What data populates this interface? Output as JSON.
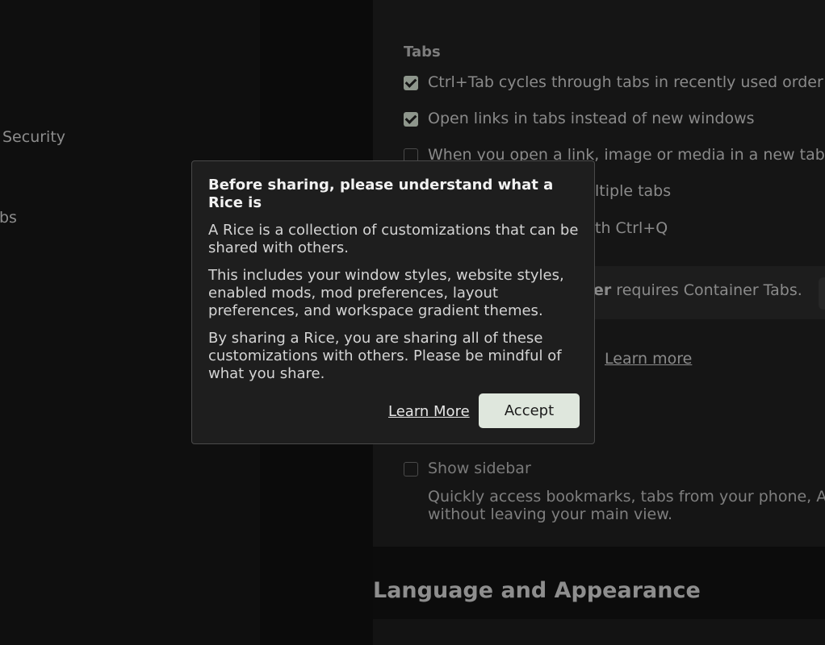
{
  "sidebar": {
    "items": [
      {
        "label": "Security"
      },
      {
        "label": "bs"
      }
    ]
  },
  "background": {
    "top_glyph": "ˇ",
    "tabs_section": {
      "title": "Tabs",
      "options": [
        {
          "label": "Ctrl+Tab cycles through tabs in recently used order",
          "checked": true
        },
        {
          "label": "Open links in tabs instead of new windows",
          "checked": true
        },
        {
          "label": "When you open a link, image or media in a new tab,",
          "checked": false
        }
      ],
      "partial_1": "ltiple tabs",
      "partial_2": "th Ctrl+Q"
    },
    "notice": {
      "bold": "er",
      "text": " requires Container Tabs."
    },
    "learn_more": "Learn more",
    "show_sidebar": {
      "label": "Show sidebar",
      "checked": false
    },
    "sidebar_description": "Quickly access bookmarks, tabs from your phone, AI without leaving your main view.",
    "language_heading": "Language and Appearance"
  },
  "dialog": {
    "title": "Before sharing, please understand what a Rice is",
    "paragraphs": [
      "A Rice is a collection of customizations that can be shared with others.",
      "This includes your window styles, website styles, enabled mods, mod preferences, layout preferences, and workspace gradient themes.",
      "By sharing a Rice, you are sharing all of these customizations with others. Please be mindful of what you share."
    ],
    "learn_more": "Learn More",
    "accept": "Accept"
  },
  "colors": {
    "accept_bg": "#dfe7dd",
    "checkbox_checked": "#8e968c",
    "dialog_bg": "#1e1e1e"
  }
}
